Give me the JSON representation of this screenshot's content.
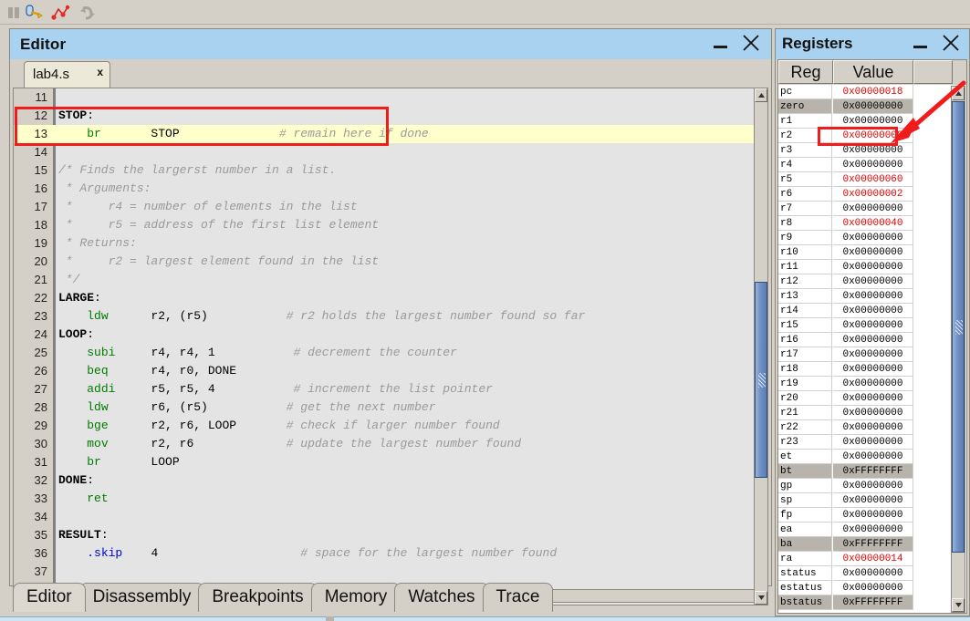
{
  "toolbar": {
    "icons": [
      {
        "name": "pause-icon",
        "label": "Pause",
        "enabled": false
      },
      {
        "name": "step-over-icon",
        "label": "Step Over",
        "enabled": true
      },
      {
        "name": "step-into-icon",
        "label": "Step Into",
        "enabled": true
      },
      {
        "name": "restart-icon",
        "label": "Restart",
        "enabled": false
      }
    ]
  },
  "editor": {
    "title": "Editor",
    "minimize_label": "Minimize",
    "close_label": "Close",
    "tab": {
      "label": "lab4.s",
      "close_glyph": "x"
    },
    "lines": [
      {
        "num": "11",
        "highlighted": false,
        "tokens": []
      },
      {
        "num": "12",
        "highlighted": false,
        "tokens": [
          {
            "t": "STOP",
            "c": "tk-label"
          },
          {
            "t": ":",
            "c": "tk-op"
          }
        ]
      },
      {
        "num": "13",
        "highlighted": true,
        "tokens": [
          {
            "t": "    ",
            "c": "tk-op"
          },
          {
            "t": "br",
            "c": "tk-instr"
          },
          {
            "t": "       STOP              ",
            "c": "tk-op"
          },
          {
            "t": "# remain here if done",
            "c": "tk-cmt"
          }
        ]
      },
      {
        "num": "14",
        "highlighted": false,
        "tokens": []
      },
      {
        "num": "15",
        "highlighted": false,
        "tokens": [
          {
            "t": "/* Finds the largerst number in a list.",
            "c": "tk-cmt"
          }
        ]
      },
      {
        "num": "16",
        "highlighted": false,
        "tokens": [
          {
            "t": " * Arguments:",
            "c": "tk-cmt"
          }
        ]
      },
      {
        "num": "17",
        "highlighted": false,
        "tokens": [
          {
            "t": " *     r4 = number of elements in the list",
            "c": "tk-cmt"
          }
        ]
      },
      {
        "num": "18",
        "highlighted": false,
        "tokens": [
          {
            "t": " *     r5 = address of the first list element",
            "c": "tk-cmt"
          }
        ]
      },
      {
        "num": "19",
        "highlighted": false,
        "tokens": [
          {
            "t": " * Returns:",
            "c": "tk-cmt"
          }
        ]
      },
      {
        "num": "20",
        "highlighted": false,
        "tokens": [
          {
            "t": " *     r2 = largest element found in the list",
            "c": "tk-cmt"
          }
        ]
      },
      {
        "num": "21",
        "highlighted": false,
        "tokens": [
          {
            "t": " */",
            "c": "tk-cmt"
          }
        ]
      },
      {
        "num": "22",
        "highlighted": false,
        "tokens": [
          {
            "t": "LARGE",
            "c": "tk-label"
          },
          {
            "t": ":",
            "c": "tk-op"
          }
        ]
      },
      {
        "num": "23",
        "highlighted": false,
        "tokens": [
          {
            "t": "    ",
            "c": "tk-op"
          },
          {
            "t": "ldw",
            "c": "tk-instr"
          },
          {
            "t": "      r2, (r5)           ",
            "c": "tk-op"
          },
          {
            "t": "# r2 holds the largest number found so far",
            "c": "tk-cmt"
          }
        ]
      },
      {
        "num": "24",
        "highlighted": false,
        "tokens": [
          {
            "t": "LOOP",
            "c": "tk-label"
          },
          {
            "t": ":",
            "c": "tk-op"
          }
        ]
      },
      {
        "num": "25",
        "highlighted": false,
        "tokens": [
          {
            "t": "    ",
            "c": "tk-op"
          },
          {
            "t": "subi",
            "c": "tk-instr"
          },
          {
            "t": "     r4, r4, 1           ",
            "c": "tk-op"
          },
          {
            "t": "# decrement the counter",
            "c": "tk-cmt"
          }
        ]
      },
      {
        "num": "26",
        "highlighted": false,
        "tokens": [
          {
            "t": "    ",
            "c": "tk-op"
          },
          {
            "t": "beq",
            "c": "tk-instr"
          },
          {
            "t": "      r4, r0, DONE",
            "c": "tk-op"
          }
        ]
      },
      {
        "num": "27",
        "highlighted": false,
        "tokens": [
          {
            "t": "    ",
            "c": "tk-op"
          },
          {
            "t": "addi",
            "c": "tk-instr"
          },
          {
            "t": "     r5, r5, 4           ",
            "c": "tk-op"
          },
          {
            "t": "# increment the list pointer",
            "c": "tk-cmt"
          }
        ]
      },
      {
        "num": "28",
        "highlighted": false,
        "tokens": [
          {
            "t": "    ",
            "c": "tk-op"
          },
          {
            "t": "ldw",
            "c": "tk-instr"
          },
          {
            "t": "      r6, (r5)           ",
            "c": "tk-op"
          },
          {
            "t": "# get the next number",
            "c": "tk-cmt"
          }
        ]
      },
      {
        "num": "29",
        "highlighted": false,
        "tokens": [
          {
            "t": "    ",
            "c": "tk-op"
          },
          {
            "t": "bge",
            "c": "tk-instr"
          },
          {
            "t": "      r2, r6, LOOP       ",
            "c": "tk-op"
          },
          {
            "t": "# check if larger number found",
            "c": "tk-cmt"
          }
        ]
      },
      {
        "num": "30",
        "highlighted": false,
        "tokens": [
          {
            "t": "    ",
            "c": "tk-op"
          },
          {
            "t": "mov",
            "c": "tk-instr"
          },
          {
            "t": "      r2, r6             ",
            "c": "tk-op"
          },
          {
            "t": "# update the largest number found",
            "c": "tk-cmt"
          }
        ]
      },
      {
        "num": "31",
        "highlighted": false,
        "tokens": [
          {
            "t": "    ",
            "c": "tk-op"
          },
          {
            "t": "br",
            "c": "tk-instr"
          },
          {
            "t": "       LOOP",
            "c": "tk-op"
          }
        ]
      },
      {
        "num": "32",
        "highlighted": false,
        "tokens": [
          {
            "t": "DONE",
            "c": "tk-label"
          },
          {
            "t": ":",
            "c": "tk-op"
          }
        ]
      },
      {
        "num": "33",
        "highlighted": false,
        "tokens": [
          {
            "t": "    ",
            "c": "tk-op"
          },
          {
            "t": "ret",
            "c": "tk-instr"
          }
        ]
      },
      {
        "num": "34",
        "highlighted": false,
        "tokens": []
      },
      {
        "num": "35",
        "highlighted": false,
        "tokens": [
          {
            "t": "RESULT",
            "c": "tk-label"
          },
          {
            "t": ":",
            "c": "tk-op"
          }
        ]
      },
      {
        "num": "36",
        "highlighted": false,
        "tokens": [
          {
            "t": "    ",
            "c": "tk-op"
          },
          {
            "t": ".skip",
            "c": "tk-dir"
          },
          {
            "t": "    4                    ",
            "c": "tk-op"
          },
          {
            "t": "# space for the largest number found",
            "c": "tk-cmt"
          }
        ]
      },
      {
        "num": "37",
        "highlighted": false,
        "tokens": []
      }
    ]
  },
  "bottom_tabs": [
    {
      "label": "Editor",
      "active": true
    },
    {
      "label": "Disassembly",
      "active": false
    },
    {
      "label": "Breakpoints",
      "active": false
    },
    {
      "label": "Memory",
      "active": false
    },
    {
      "label": "Watches",
      "active": false
    },
    {
      "label": "Trace",
      "active": false
    }
  ],
  "registers": {
    "title": "Registers",
    "minimize_label": "Minimize",
    "close_label": "Close",
    "columns": [
      "Reg",
      "Value",
      ""
    ],
    "rows": [
      {
        "reg": "pc",
        "value": "0x00000018",
        "changed": true,
        "selected": false
      },
      {
        "reg": "zero",
        "value": "0x00000000",
        "changed": false,
        "selected": true
      },
      {
        "reg": "r1",
        "value": "0x00000000",
        "changed": false,
        "selected": false
      },
      {
        "reg": "r2",
        "value": "0x00000008",
        "changed": true,
        "selected": false
      },
      {
        "reg": "r3",
        "value": "0x00000000",
        "changed": false,
        "selected": false
      },
      {
        "reg": "r4",
        "value": "0x00000000",
        "changed": false,
        "selected": false
      },
      {
        "reg": "r5",
        "value": "0x00000060",
        "changed": true,
        "selected": false
      },
      {
        "reg": "r6",
        "value": "0x00000002",
        "changed": true,
        "selected": false
      },
      {
        "reg": "r7",
        "value": "0x00000000",
        "changed": false,
        "selected": false
      },
      {
        "reg": "r8",
        "value": "0x00000040",
        "changed": true,
        "selected": false
      },
      {
        "reg": "r9",
        "value": "0x00000000",
        "changed": false,
        "selected": false
      },
      {
        "reg": "r10",
        "value": "0x00000000",
        "changed": false,
        "selected": false
      },
      {
        "reg": "r11",
        "value": "0x00000000",
        "changed": false,
        "selected": false
      },
      {
        "reg": "r12",
        "value": "0x00000000",
        "changed": false,
        "selected": false
      },
      {
        "reg": "r13",
        "value": "0x00000000",
        "changed": false,
        "selected": false
      },
      {
        "reg": "r14",
        "value": "0x00000000",
        "changed": false,
        "selected": false
      },
      {
        "reg": "r15",
        "value": "0x00000000",
        "changed": false,
        "selected": false
      },
      {
        "reg": "r16",
        "value": "0x00000000",
        "changed": false,
        "selected": false
      },
      {
        "reg": "r17",
        "value": "0x00000000",
        "changed": false,
        "selected": false
      },
      {
        "reg": "r18",
        "value": "0x00000000",
        "changed": false,
        "selected": false
      },
      {
        "reg": "r19",
        "value": "0x00000000",
        "changed": false,
        "selected": false
      },
      {
        "reg": "r20",
        "value": "0x00000000",
        "changed": false,
        "selected": false
      },
      {
        "reg": "r21",
        "value": "0x00000000",
        "changed": false,
        "selected": false
      },
      {
        "reg": "r22",
        "value": "0x00000000",
        "changed": false,
        "selected": false
      },
      {
        "reg": "r23",
        "value": "0x00000000",
        "changed": false,
        "selected": false
      },
      {
        "reg": "et",
        "value": "0x00000000",
        "changed": false,
        "selected": false
      },
      {
        "reg": "bt",
        "value": "0xFFFFFFFF",
        "changed": false,
        "selected": true
      },
      {
        "reg": "gp",
        "value": "0x00000000",
        "changed": false,
        "selected": false
      },
      {
        "reg": "sp",
        "value": "0x00000000",
        "changed": false,
        "selected": false
      },
      {
        "reg": "fp",
        "value": "0x00000000",
        "changed": false,
        "selected": false
      },
      {
        "reg": "ea",
        "value": "0x00000000",
        "changed": false,
        "selected": false
      },
      {
        "reg": "ba",
        "value": "0xFFFFFFFF",
        "changed": false,
        "selected": true
      },
      {
        "reg": "ra",
        "value": "0x00000014",
        "changed": true,
        "selected": false
      },
      {
        "reg": "status",
        "value": "0x00000000",
        "changed": false,
        "selected": false
      },
      {
        "reg": "estatus",
        "value": "0x00000000",
        "changed": false,
        "selected": false
      },
      {
        "reg": "bstatus",
        "value": "0xFFFFFFFF",
        "changed": false,
        "selected": true
      }
    ]
  },
  "annotations": {
    "code_box_label": "highlighted STOP/br lines",
    "register_box_label": "highlighted r2 register row",
    "arrow_label": "arrow pointing to r2 row",
    "accent_color": "#f01c1c"
  },
  "colors": {
    "titlebar": "#a8d2f0",
    "window_chrome": "#d4d0c8",
    "code_bg": "#e4e4e4",
    "current_line": "#ffffcc",
    "changed_value": "#e00000",
    "instruction": "#007a00",
    "directive": "#0000cc",
    "comment": "#9a9a9a"
  }
}
